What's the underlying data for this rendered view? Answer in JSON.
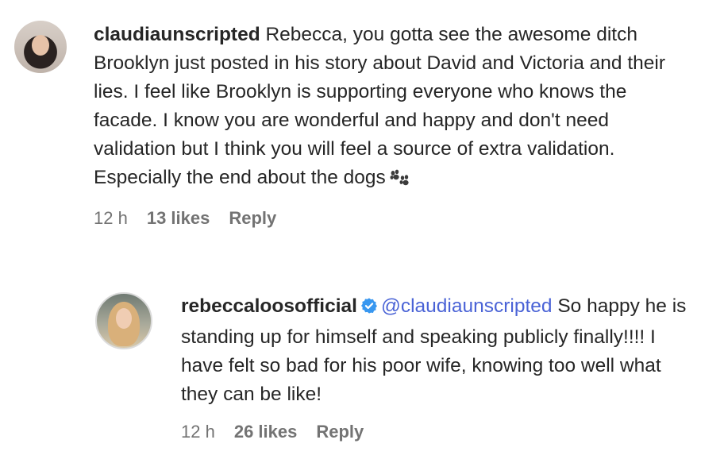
{
  "comments": [
    {
      "username": "claudiaunscripted",
      "text": "Rebecca, you gotta see the awesome ditch Brooklyn just posted in his story about David and Victoria and their lies. I feel like Brooklyn is supporting everyone who knows the facade. I know you are wonderful and happy and don't need validation but I think you will feel a source of extra validation. Especially the end about the dogs",
      "emoji_icon": "paw-prints-icon",
      "time": "12 h",
      "likes": "13 likes",
      "reply_label": "Reply"
    }
  ],
  "reply": {
    "username": "rebeccaloosofficial",
    "verified_icon": "verified-badge-icon",
    "mention": "@claudiaunscripted",
    "text": "So happy he is standing up for himself and speaking publicly finally!!!! I have felt so bad for his poor wife, knowing too well what they can be like!",
    "time": "12 h",
    "likes": "26 likes",
    "reply_label": "Reply"
  },
  "colors": {
    "text": "#262626",
    "meta": "#737373",
    "mention": "#4a63d6",
    "verified": "#3897f0"
  }
}
